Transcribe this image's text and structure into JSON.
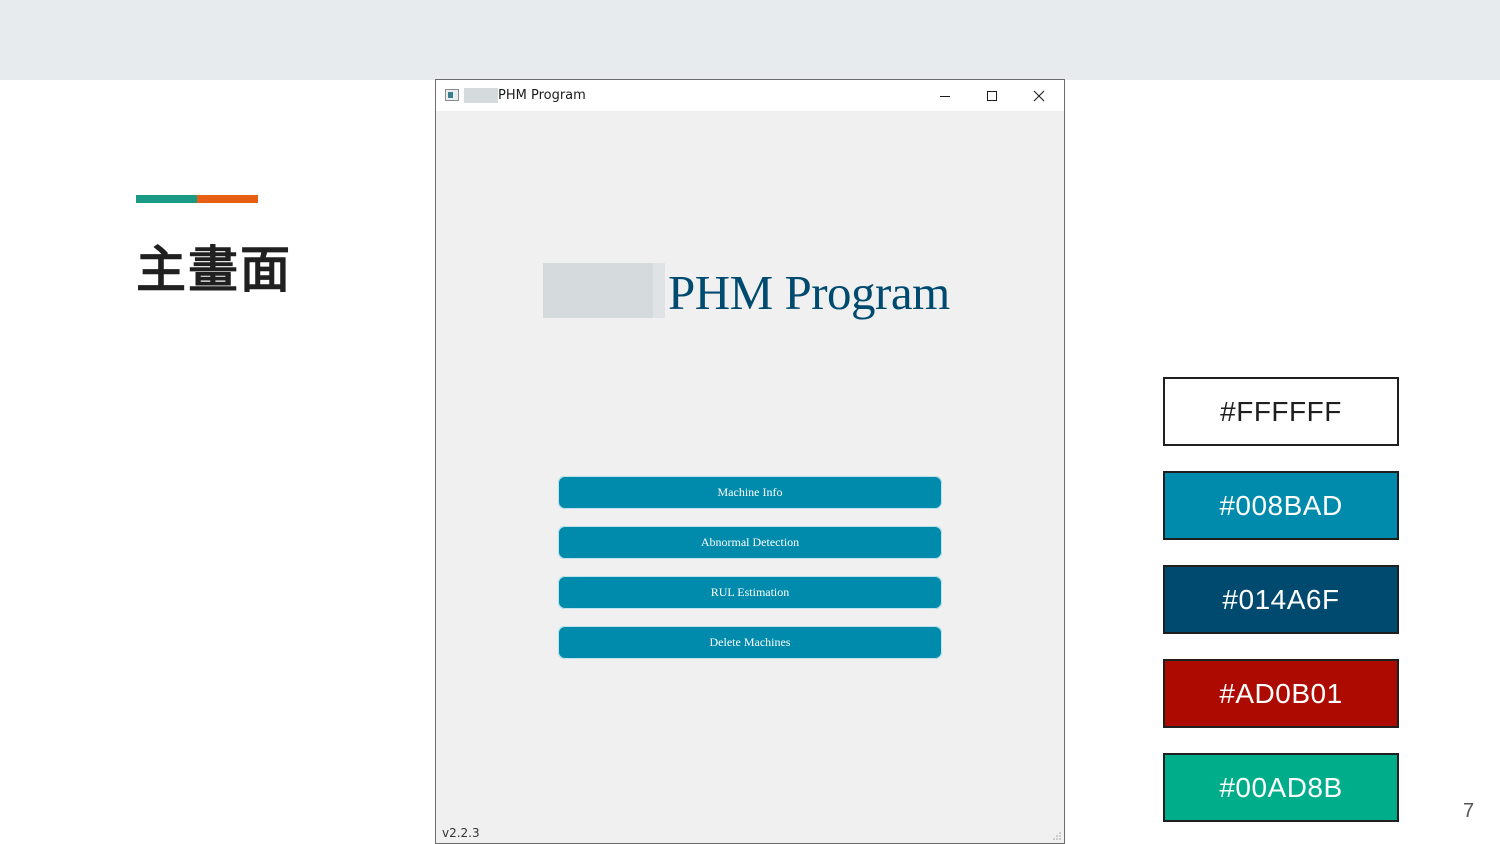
{
  "slide": {
    "title": "主畫面",
    "page_number": "7",
    "accent_colors": [
      "#1b9a86",
      "#e65f12"
    ]
  },
  "app": {
    "window_title": "PHM Program",
    "heading": "PHM Program",
    "version": "v2.2.3",
    "icons": {
      "app": "app-icon",
      "minimize": "minimize-icon",
      "maximize": "maximize-icon",
      "close": "close-icon",
      "resize": "resize-grip-icon"
    },
    "buttons": [
      {
        "label": "Machine Info"
      },
      {
        "label": "Abnormal Detection"
      },
      {
        "label": "RUL Estimation"
      },
      {
        "label": "Delete Machines"
      }
    ],
    "colors": {
      "button_bg": "#008BAD",
      "heading_color": "#014A6F",
      "window_bg": "#f0f0f0"
    }
  },
  "palette": [
    {
      "label": "#FFFFFF",
      "color": "#FFFFFF"
    },
    {
      "label": "#008BAD",
      "color": "#008BAD"
    },
    {
      "label": "#014A6F",
      "color": "#014A6F"
    },
    {
      "label": "#AD0B01",
      "color": "#AD0B01"
    },
    {
      "label": "#00AD8B",
      "color": "#00AD8B"
    }
  ]
}
